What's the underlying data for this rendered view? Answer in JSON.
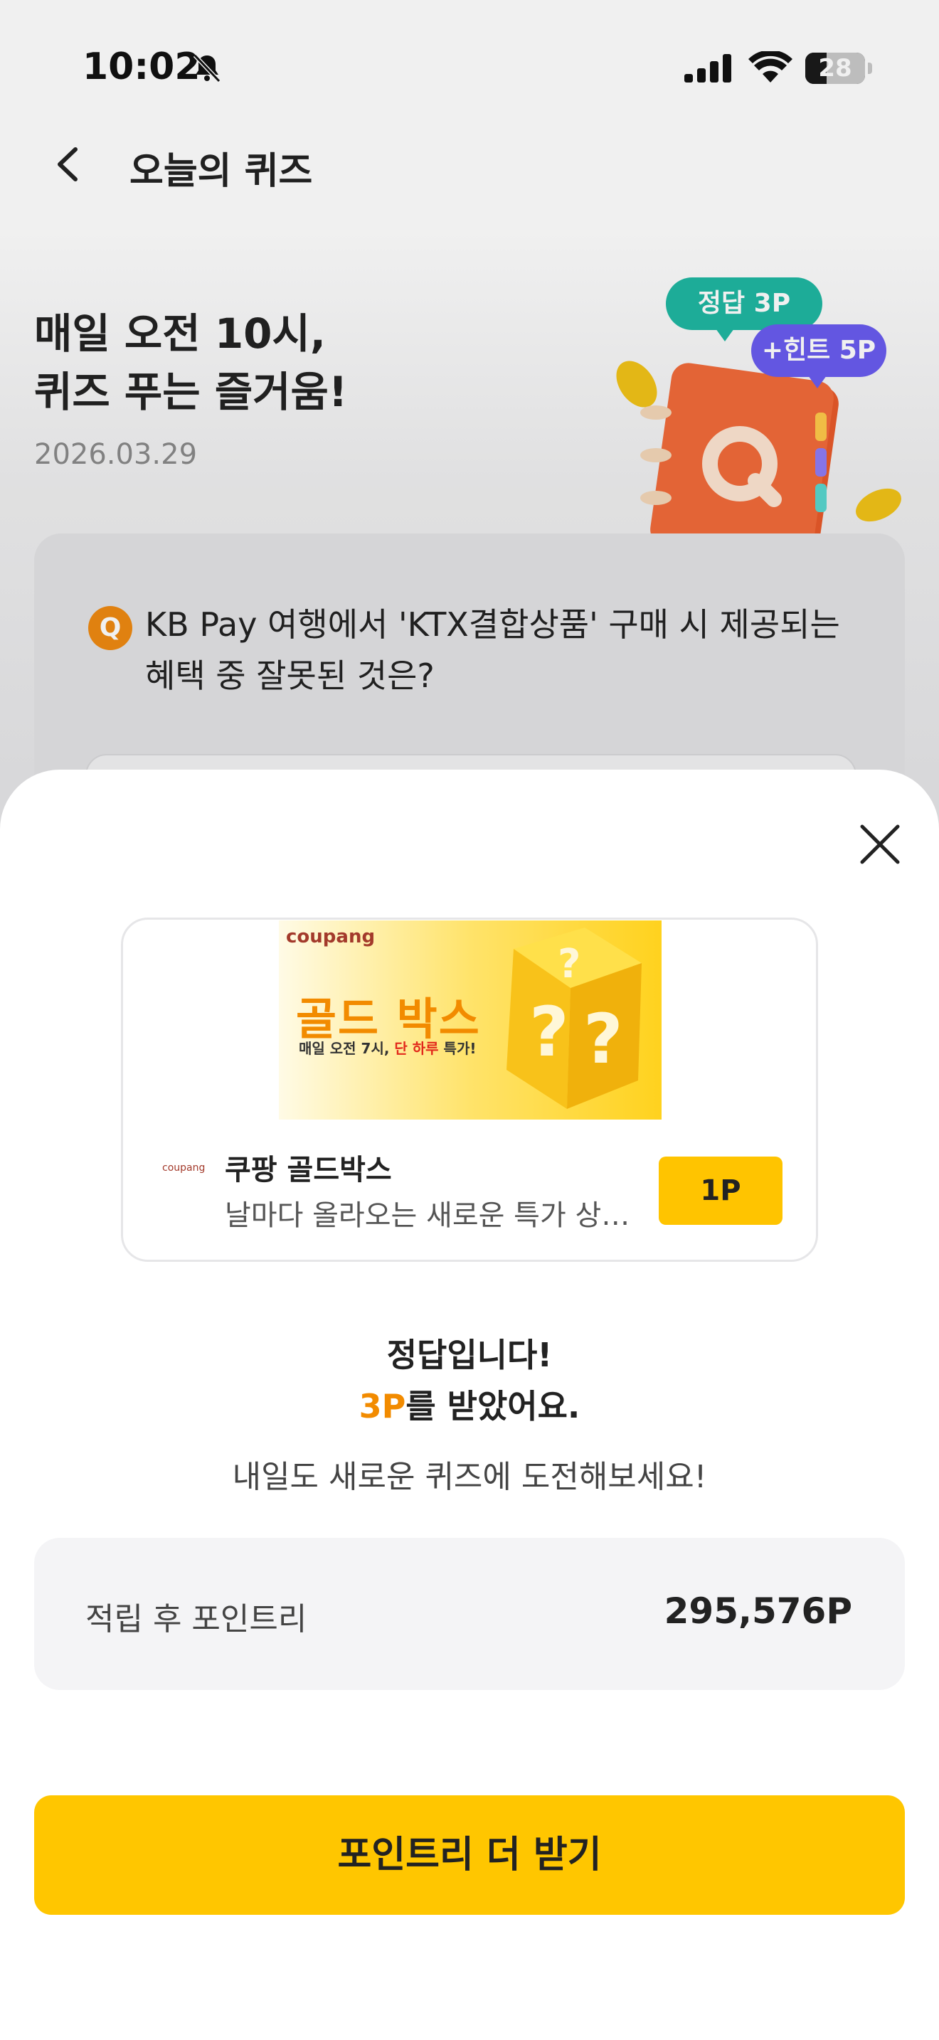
{
  "status_bar": {
    "time": "10:02",
    "battery": "28",
    "icons": [
      "bell-off-icon",
      "signal-icon",
      "wifi-icon",
      "battery-icon"
    ]
  },
  "header": {
    "title": "오늘의 퀴즈",
    "back_icon": "chevron-left-icon"
  },
  "hero": {
    "title_line1": "매일 오전 10시,",
    "title_line2": "퀴즈 푸는 즐거움!",
    "date": "2026.03.29",
    "bubble_answer": "정답 3P",
    "bubble_hint": "+힌트 5P"
  },
  "question": {
    "badge": "Q",
    "text": "KB Pay 여행에서 'KTX결합상품' 구매 시 제공되는 혜택 중 잘못된 것은?"
  },
  "sheet": {
    "close_icon": "close-icon",
    "ad": {
      "banner_logo": "coupang",
      "banner_headline": "골드 박스",
      "banner_sub_prefix": "매일 오전 7시, ",
      "banner_sub_red": "단 하루",
      "banner_sub_suffix": " 특가!",
      "brand_small": "coupang",
      "name": "쿠팡 골드박스",
      "description": "날마다 올라오는 새로운 특가 상품...",
      "point_button": "1P"
    },
    "result": {
      "title": "정답입니다!",
      "points": "3P",
      "points_suffix": "를 받았어요.",
      "subtitle": "내일도 새로운 퀴즈에 도전해보세요!"
    },
    "balance": {
      "label": "적립 후 포인트리",
      "value": "295,576P"
    },
    "cta": {
      "label": "포인트리 더 받기"
    }
  },
  "colors": {
    "accent_yellow": "#ffc600",
    "orange": "#f28b00",
    "bubble_green": "#1fb7a2",
    "bubble_purple": "#6a5cf0"
  }
}
